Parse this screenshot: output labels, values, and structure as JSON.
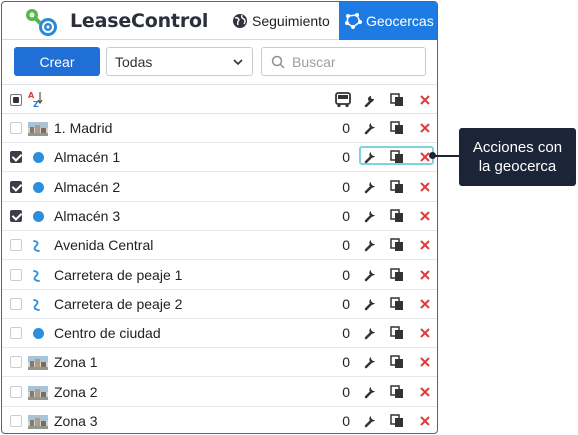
{
  "header": {
    "brand": "LeaseControl",
    "tabs": [
      {
        "label": "Seguimiento",
        "active": false
      },
      {
        "label": "Geocercas",
        "active": true
      }
    ]
  },
  "toolbar": {
    "create_label": "Crear",
    "filter_value": "Todas",
    "search_placeholder": "Buscar"
  },
  "table": {
    "rows": [
      {
        "name": "1. Madrid",
        "count": "0",
        "checked": false,
        "icon": "image-thumbnail"
      },
      {
        "name": "Almacén 1",
        "count": "0",
        "checked": true,
        "icon": "blue-dot"
      },
      {
        "name": "Almacén 2",
        "count": "0",
        "checked": true,
        "icon": "blue-dot"
      },
      {
        "name": "Almacén 3",
        "count": "0",
        "checked": true,
        "icon": "blue-dot"
      },
      {
        "name": "Avenida Central",
        "count": "0",
        "checked": false,
        "icon": "route-icon"
      },
      {
        "name": "Carretera de peaje 1",
        "count": "0",
        "checked": false,
        "icon": "route-icon"
      },
      {
        "name": "Carretera de peaje 2",
        "count": "0",
        "checked": false,
        "icon": "route-icon"
      },
      {
        "name": "Centro de ciudad",
        "count": "0",
        "checked": false,
        "icon": "blue-dot"
      },
      {
        "name": "Zona 1",
        "count": "0",
        "checked": false,
        "icon": "image-thumbnail"
      },
      {
        "name": "Zona 2",
        "count": "0",
        "checked": false,
        "icon": "image-thumbnail"
      },
      {
        "name": "Zona 3",
        "count": "0",
        "checked": false,
        "icon": "image-thumbnail"
      }
    ]
  },
  "callout": {
    "line1": "Acciones con",
    "line2": "la geocerca"
  },
  "colors": {
    "accent": "#1e7be4",
    "dot": "#2b8fe0",
    "delete": "#e03b3b",
    "callout_bg": "#1c2538"
  }
}
